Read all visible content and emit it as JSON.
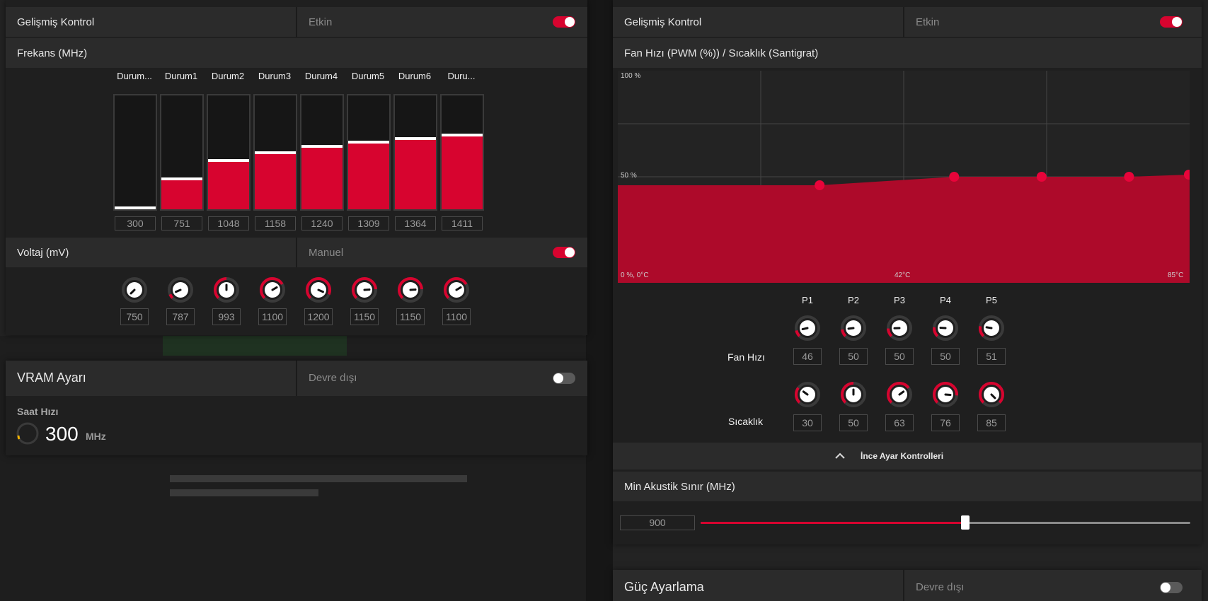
{
  "left": {
    "advanced_control": {
      "label": "Gelişmiş Kontrol",
      "status": "Etkin",
      "enabled": true
    },
    "frequency": {
      "title": "Frekans (MHz)",
      "states": [
        {
          "name": "Durum...",
          "value": "300",
          "level": 0.0
        },
        {
          "name": "Durum1",
          "value": "751",
          "level": 0.27
        },
        {
          "name": "Durum2",
          "value": "1048",
          "level": 0.43
        },
        {
          "name": "Durum3",
          "value": "1158",
          "level": 0.5
        },
        {
          "name": "Durum4",
          "value": "1240",
          "level": 0.55
        },
        {
          "name": "Durum5",
          "value": "1309",
          "level": 0.59
        },
        {
          "name": "Durum6",
          "value": "1364",
          "level": 0.62
        },
        {
          "name": "Duru...",
          "value": "1411",
          "level": 0.65
        }
      ]
    },
    "voltage": {
      "label": "Voltaj (mV)",
      "status": "Manuel",
      "enabled": true,
      "knobs": [
        {
          "value": "750",
          "level": 0.0
        },
        {
          "value": "787",
          "level": 0.08
        },
        {
          "value": "993",
          "level": 0.5
        },
        {
          "value": "1100",
          "level": 0.72
        },
        {
          "value": "1200",
          "level": 0.92
        },
        {
          "value": "1150",
          "level": 0.82
        },
        {
          "value": "1150",
          "level": 0.82
        },
        {
          "value": "1100",
          "level": 0.72
        }
      ]
    },
    "vram": {
      "label": "VRAM Ayarı",
      "status": "Devre dışı",
      "enabled": false,
      "clock_label": "Saat Hızı",
      "clock_value": "300",
      "clock_unit": "MHz"
    }
  },
  "right": {
    "advanced_control": {
      "label": "Gelişmiş Kontrol",
      "status": "Etkin",
      "enabled": true
    },
    "fan_curve": {
      "title": "Fan Hızı (PWM (%)) / Sıcaklık (Santigrat)",
      "y_top": "100 %",
      "y_mid": "50 %",
      "origin": "0 %, 0°C",
      "x_mid": "42°C",
      "x_max": "85°C"
    },
    "chart_data": {
      "type": "area",
      "x": [
        30,
        50,
        63,
        76,
        85
      ],
      "y": [
        46,
        50,
        50,
        50,
        51
      ],
      "xlim": [
        0,
        85
      ],
      "ylim": [
        0,
        100
      ],
      "xlabel": "",
      "ylabel": ""
    },
    "points": {
      "columns": [
        "P1",
        "P2",
        "P3",
        "P4",
        "P5"
      ],
      "fan_label": "Fan Hızı",
      "fan_values": [
        "46",
        "50",
        "50",
        "50",
        "51"
      ],
      "temp_label": "Sıcaklık",
      "temp_values": [
        "30",
        "50",
        "63",
        "76",
        "85"
      ]
    },
    "fine_tune_label": "İnce Ayar Kontrolleri",
    "min_acoustic": {
      "label": "Min Akustik Sınır (MHz)",
      "value": "900",
      "level": 0.54
    },
    "power": {
      "label": "Güç Ayarlama",
      "status": "Devre dışı",
      "enabled": false
    }
  },
  "colors": {
    "accent": "#d7042f",
    "panel": "#1f1f1f",
    "header": "#2b2b2b"
  }
}
